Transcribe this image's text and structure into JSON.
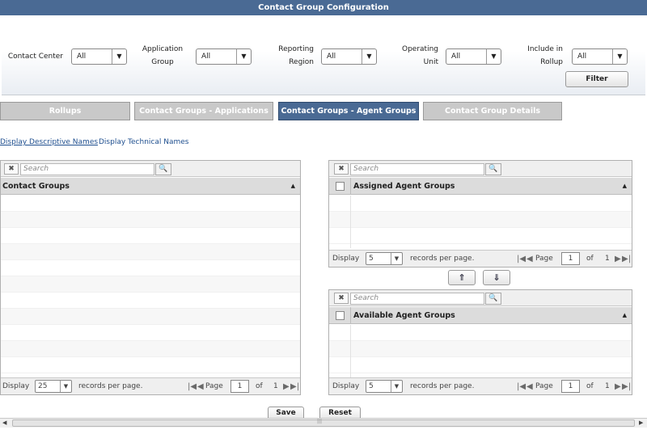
{
  "title": "Contact Group Configuration",
  "filters": [
    {
      "label": "Contact Center",
      "value": "All"
    },
    {
      "label": "Application Group",
      "value": "All"
    },
    {
      "label": "Reporting Region",
      "value": "All"
    },
    {
      "label": "Operating Unit",
      "value": "All"
    },
    {
      "label": "Include in Rollup",
      "value": "All"
    }
  ],
  "filter_button": "Filter",
  "tabs": [
    {
      "label": "Rollups",
      "active": false
    },
    {
      "label": "Contact Groups - Applications",
      "active": false
    },
    {
      "label": "Contact Groups - Agent Groups",
      "active": true
    },
    {
      "label": "Contact Group Details",
      "active": false
    }
  ],
  "links": {
    "descriptive": "Display Descriptive Names",
    "technical": "Display Technical Names"
  },
  "search_placeholder": "Search",
  "contact_groups": {
    "header": "Contact Groups",
    "pager": {
      "display": "Display",
      "per_page_value": "25",
      "records_text": "records per page.",
      "page_label": "Page",
      "page_value": "1",
      "of_label": "of",
      "total_pages": "1"
    }
  },
  "assigned": {
    "header": "Assigned Agent Groups",
    "pager": {
      "display": "Display",
      "per_page_value": "5",
      "records_text": "records per page.",
      "page_label": "Page",
      "page_value": "1",
      "of_label": "of",
      "total_pages": "1"
    }
  },
  "available": {
    "header": "Available Agent Groups",
    "pager": {
      "display": "Display",
      "per_page_value": "5",
      "records_text": "records per page.",
      "page_label": "Page",
      "page_value": "1",
      "of_label": "of",
      "total_pages": "1"
    }
  },
  "buttons": {
    "save": "Save",
    "reset": "Reset"
  },
  "icons": {
    "clear": "✖",
    "search": "🔍",
    "dropdown": "▼",
    "sort": "▲",
    "first": "|◀",
    "prev": "◀",
    "next": "▶",
    "last": "▶|",
    "move_up": "⇑",
    "move_down": "⇓",
    "scroll_left": "◀",
    "scroll_right": "▶",
    "grip": "|||"
  },
  "colors": {
    "accent": "#4a6a94",
    "link": "#1f4f8f",
    "tab_inactive": "#c9c9c9"
  }
}
